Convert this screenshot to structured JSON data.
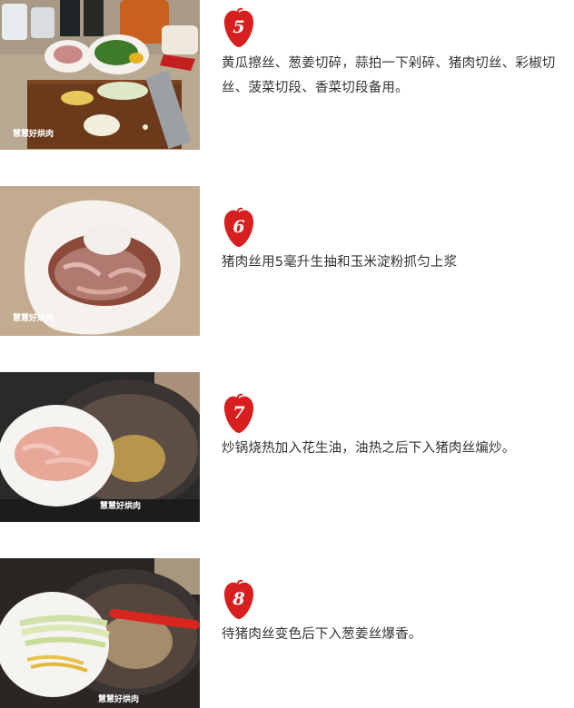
{
  "steps": [
    {
      "number": "5",
      "text": "黄瓜擦丝、葱姜切碎，蒜拍一下剁碎、猪肉切丝、彩椒切丝、菠菜切段、香菜切段备用。",
      "watermark": "慧慧好烘肉"
    },
    {
      "number": "6",
      "text": "猪肉丝用5毫升生抽和玉米淀粉抓匀上浆",
      "watermark": "慧慧好烘肉"
    },
    {
      "number": "7",
      "text": "炒锅烧热加入花生油，油热之后下入猪肉丝煸炒。",
      "watermark": "慧慧好烘肉"
    },
    {
      "number": "8",
      "text": "待猪肉丝变色后下入葱姜丝爆香。",
      "watermark": "慧慧好烘肉"
    }
  ],
  "colors": {
    "badge_red": "#d81f1f",
    "text": "#333333"
  }
}
